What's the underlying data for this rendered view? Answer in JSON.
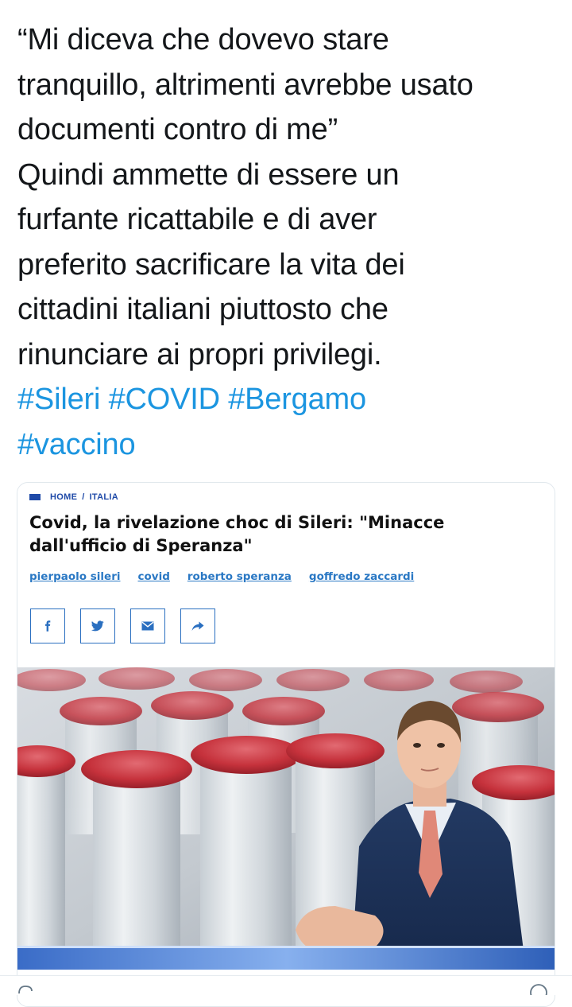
{
  "tweet": {
    "lines": [
      "“Mi diceva che dovevo stare",
      "tranquillo, altrimenti avrebbe usato",
      "documenti contro di me”",
      "Quindi ammette di essere un",
      "furfante ricattabile e di aver",
      "preferito sacrificare la vita dei",
      "cittadini italiani piuttosto che",
      "rinunciare ai propri privilegi."
    ],
    "hashtags": [
      "#Sileri",
      "#COVID",
      "#Bergamo",
      "#vaccino"
    ]
  },
  "card": {
    "breadcrumb": [
      "HOME",
      "ITALIA"
    ],
    "breadcrumb_sep": "/",
    "headline": "Covid, la rivelazione choc di Sileri: \"Minacce dall'ufficio di Speranza\"",
    "tags": [
      "pierpaolo sileri",
      "covid",
      "roberto speranza",
      "goffredo zaccardi"
    ],
    "share_buttons": [
      "facebook-icon",
      "twitter-icon",
      "mail-icon",
      "share-arrow-icon"
    ],
    "image": "photo-vaccine-vials-man-in-suit"
  },
  "colors": {
    "hashtag": "#1b95e0",
    "breadcrumb": "#1f4aa8",
    "tag_link": "#2a78c4",
    "share_border": "#2a6fc0"
  },
  "footer_icons": [
    "reply-icon",
    "share-icon"
  ]
}
